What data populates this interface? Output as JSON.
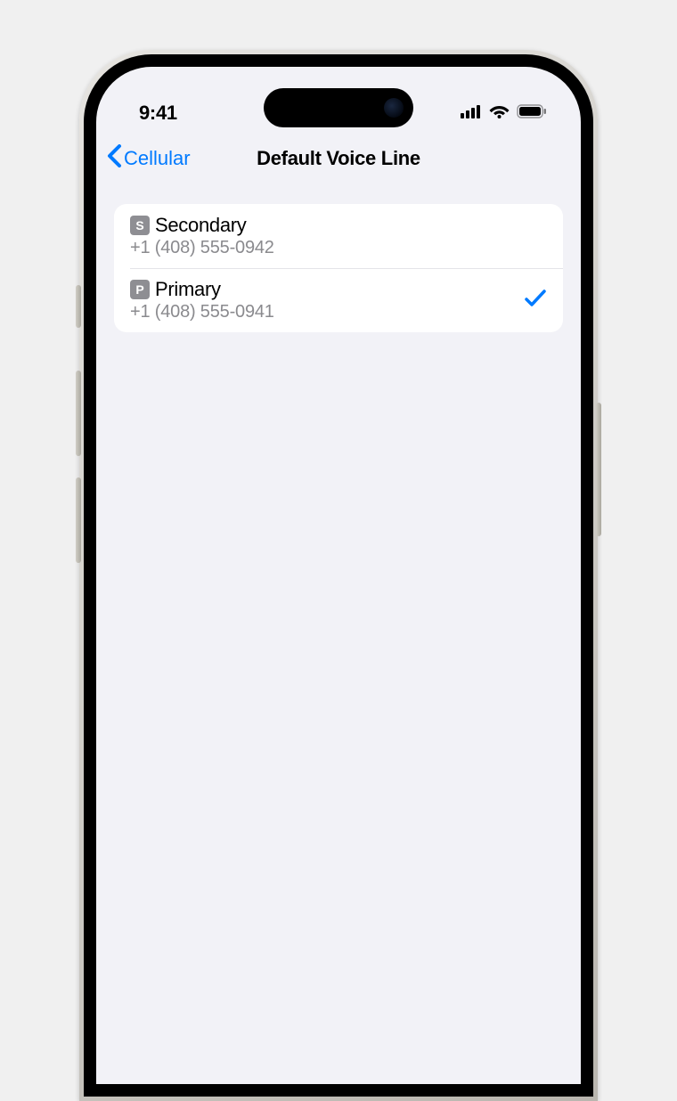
{
  "status": {
    "time": "9:41"
  },
  "nav": {
    "back_label": "Cellular",
    "title": "Default Voice Line"
  },
  "lines": [
    {
      "badge": "S",
      "label": "Secondary",
      "number": "+1 (408) 555-0942",
      "selected": false
    },
    {
      "badge": "P",
      "label": "Primary",
      "number": "+1 (408) 555-0941",
      "selected": true
    }
  ]
}
